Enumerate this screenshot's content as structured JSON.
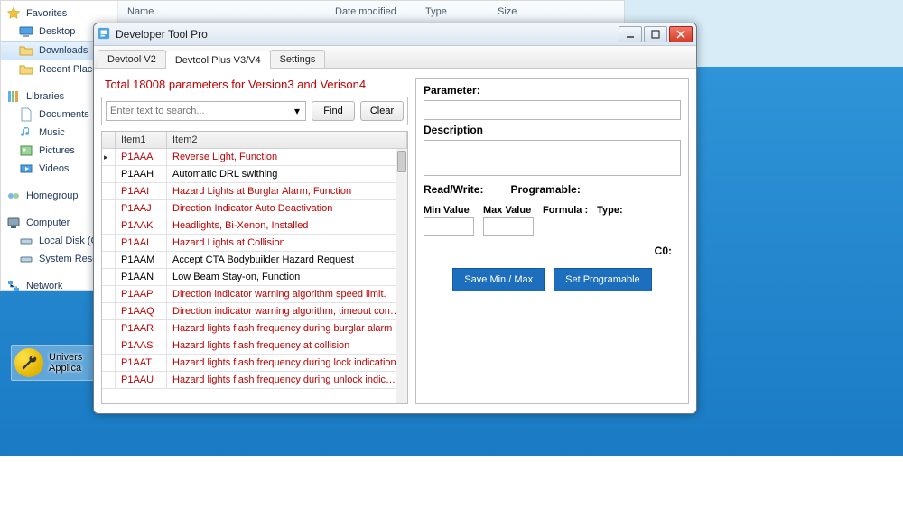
{
  "explorer": {
    "columns": {
      "name": "Name",
      "date": "Date modified",
      "type": "Type",
      "size": "Size"
    },
    "sidebar": {
      "favorites": {
        "title": "Favorites",
        "items": [
          "Desktop",
          "Downloads",
          "Recent Place"
        ]
      },
      "libraries": {
        "title": "Libraries",
        "items": [
          "Documents",
          "Music",
          "Pictures",
          "Videos"
        ]
      },
      "homegroup": {
        "title": "Homegroup"
      },
      "computer": {
        "title": "Computer",
        "items": [
          "Local Disk (C",
          "System Rese"
        ]
      },
      "network": {
        "title": "Network"
      }
    }
  },
  "desktop_shortcut": {
    "title": "Univers",
    "subtitle": "Applica"
  },
  "app": {
    "title": "Developer Tool Pro",
    "tabs": [
      "Devtool V2",
      "Devtool Plus V3/V4",
      "Settings"
    ],
    "active_tab": 1,
    "total_line": "Total 18008 parameters for Version3 and Verison4",
    "search_placeholder": "Enter text to search...",
    "find_btn": "Find",
    "clear_btn": "Clear",
    "grid": {
      "headers": {
        "item1": "Item1",
        "item2": "Item2"
      },
      "rows": [
        {
          "id": "P1AAA",
          "desc": "Reverse Light, Function",
          "red": true
        },
        {
          "id": "P1AAH",
          "desc": "Automatic DRL swithing",
          "red": false
        },
        {
          "id": "P1AAI",
          "desc": "Hazard Lights at Burglar Alarm, Function",
          "red": true
        },
        {
          "id": "P1AAJ",
          "desc": "Direction Indicator Auto Deactivation",
          "red": true
        },
        {
          "id": "P1AAK",
          "desc": "Headlights, Bi-Xenon, Installed",
          "red": true
        },
        {
          "id": "P1AAL",
          "desc": "Hazard Lights at Collision",
          "red": true
        },
        {
          "id": "P1AAM",
          "desc": "Accept CTA Bodybuilder Hazard Request",
          "red": false
        },
        {
          "id": "P1AAN",
          "desc": "Low Beam Stay-on, Function",
          "red": false
        },
        {
          "id": "P1AAP",
          "desc": "Direction indicator warning algorithm speed limit.",
          "red": true
        },
        {
          "id": "P1AAQ",
          "desc": "Direction indicator warning algorithm, timeout configu...",
          "red": true
        },
        {
          "id": "P1AAR",
          "desc": "Hazard lights flash frequency during burglar alarm",
          "red": true
        },
        {
          "id": "P1AAS",
          "desc": "Hazard lights flash frequency at collision",
          "red": true
        },
        {
          "id": "P1AAT",
          "desc": "Hazard lights flash frequency during lock indication.",
          "red": true
        },
        {
          "id": "P1AAU",
          "desc": "Hazard lights flash frequency during unlock indication",
          "red": true
        }
      ]
    },
    "right": {
      "param_label": "Parameter:",
      "desc_label": "Description",
      "rw_label": "Read/Write:",
      "prog_label": "Programable:",
      "min_label": "Min Value",
      "max_label": "Max Value",
      "formula_label": "Formula :",
      "type_label": "Type:",
      "c0_label": "C0:",
      "save_btn": "Save Min / Max",
      "set_prog_btn": "Set Programable"
    }
  }
}
